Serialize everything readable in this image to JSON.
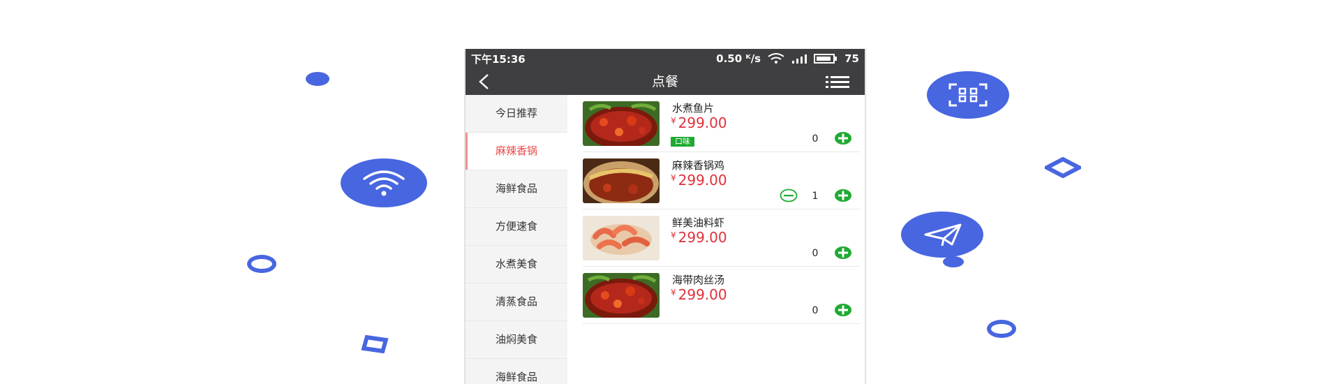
{
  "status_bar": {
    "time": "下午15:36",
    "network_speed": "0.50 ᴷ/s",
    "battery": "75"
  },
  "nav": {
    "title": "点餐"
  },
  "categories": [
    {
      "label": "今日推荐"
    },
    {
      "label": "麻辣香锅"
    },
    {
      "label": "海鲜食品"
    },
    {
      "label": "方便速食"
    },
    {
      "label": "水煮美食"
    },
    {
      "label": "清蒸食品"
    },
    {
      "label": "油焖美食"
    },
    {
      "label": "海鲜食品"
    }
  ],
  "active_category_index": 1,
  "dishes": [
    {
      "name": "水煮鱼片",
      "currency": "¥",
      "price": "299.00",
      "tag": "口味",
      "quantity": "0"
    },
    {
      "name": "麻辣香锅鸡",
      "currency": "¥",
      "price": "299.00",
      "quantity": "1"
    },
    {
      "name": "鲜美油料虾",
      "currency": "¥",
      "price": "299.00",
      "quantity": "0"
    },
    {
      "name": "海带肉丝汤",
      "currency": "¥",
      "price": "299.00",
      "quantity": "0"
    }
  ],
  "colors": {
    "accent_blue": "#4866e0",
    "price_red": "#e0303c",
    "plus_green": "#1faa32",
    "header_dark": "#3f3f41",
    "active_category": "#e94b4b"
  },
  "icons": {
    "wifi_badge": "wifi-icon",
    "qr_badge": "qr-scan-icon",
    "send_badge": "paper-plane-icon"
  }
}
